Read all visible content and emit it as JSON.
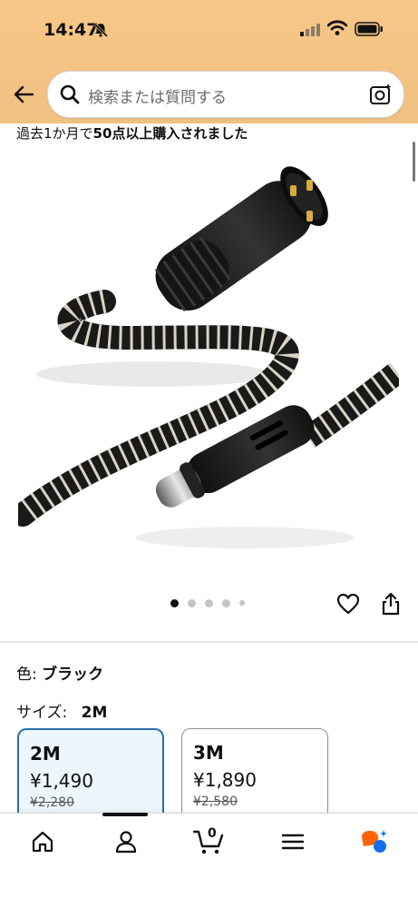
{
  "status": {
    "time": "14:47"
  },
  "search": {
    "placeholder": "検索または質問する"
  },
  "purchase_note": {
    "prefix": "過去1か月で",
    "bold": "50点以上購入されました"
  },
  "carousel": {
    "total_dots": 5,
    "active_index": 0
  },
  "variant": {
    "color_label": "色:",
    "color_value": "ブラック",
    "size_label": "サイズ:",
    "size_value": "2M",
    "options": [
      {
        "size": "2M",
        "price": "¥1,490",
        "list_price": "¥2,280",
        "selected": true
      },
      {
        "size": "3M",
        "price": "¥1,890",
        "list_price": "¥2,580",
        "selected": false
      }
    ]
  },
  "bottom_nav": {
    "items": [
      "home-icon",
      "account-icon",
      "cart-icon",
      "menu-icon",
      "rufus-icon"
    ],
    "cart_count": "0"
  },
  "colors": {
    "header": "#f3c283",
    "selected_border": "#2a6fa8",
    "selected_bg": "#edf6fb",
    "rufus_orange": "#ff6200",
    "rufus_blue": "#1570ef"
  }
}
